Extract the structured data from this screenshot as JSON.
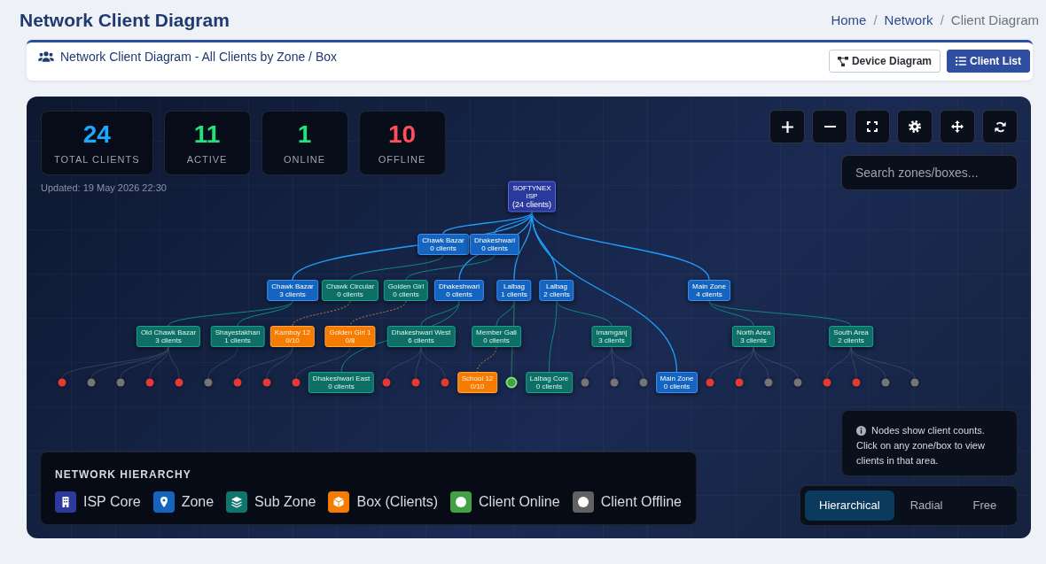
{
  "header": {
    "title": "Network Client Diagram",
    "separator": "/",
    "breadcrumb": [
      {
        "label": "Home",
        "current": false
      },
      {
        "label": "Network",
        "current": false
      },
      {
        "label": "Client Diagram",
        "current": true
      }
    ]
  },
  "card": {
    "title": "Network Client Diagram - All Clients by Zone / Box",
    "buttons": [
      {
        "label": "Device Diagram",
        "kind": "outline"
      },
      {
        "label": "Client List",
        "kind": "primary"
      }
    ]
  },
  "diagram": {
    "stats": [
      {
        "value": "24",
        "label": "TOTAL CLIENTS",
        "color": "#1ea7ff"
      },
      {
        "value": "11",
        "label": "ACTIVE",
        "color": "#22e07a"
      },
      {
        "value": "1",
        "label": "ONLINE",
        "color": "#22e07a"
      },
      {
        "value": "10",
        "label": "OFFLINE",
        "color": "#ff4d5e"
      }
    ],
    "updated": "Updated: 19 May 2026 22:30",
    "search": {
      "placeholder": "Search zones/boxes..."
    },
    "tree": {
      "kind": "isp",
      "name": "SOFTYNEX ISP",
      "count": "(24 clients)",
      "children": [
        {
          "kind": "zone",
          "name": "Chawk Bazar",
          "count": "3 clients",
          "children": [
            {
              "kind": "subzone",
              "name": "Old Chawk Bazar",
              "count": "3 clients",
              "children": [
                {
                  "kind": "client",
                  "color": "#e53935"
                },
                {
                  "kind": "client",
                  "color": "#757575"
                },
                {
                  "kind": "client",
                  "color": "#757575"
                },
                {
                  "kind": "client",
                  "color": "#e53935"
                },
                {
                  "kind": "client",
                  "color": "#e53935"
                }
              ]
            },
            {
              "kind": "subzone",
              "name": "Shayestakhan",
              "count": "1 clients",
              "children": [
                {
                  "kind": "client",
                  "color": "#757575"
                }
              ]
            }
          ]
        },
        {
          "kind": "zone",
          "name": "Chawk Bazar",
          "count": "0 clients",
          "children": [
            {
              "kind": "subzone",
              "name": "Chawk Circular",
              "count": "0 clients",
              "children": [
                {
                  "kind": "box",
                  "name": "Kamboy 12",
                  "count": "0/10",
                  "children": [
                    {
                      "kind": "client",
                      "color": "#e53935"
                    },
                    {
                      "kind": "client",
                      "color": "#e53935"
                    }
                  ]
                }
              ]
            }
          ]
        },
        {
          "kind": "zone",
          "name": "Dhakeshwari",
          "count": "0 clients",
          "children": [
            {
              "kind": "subzone",
              "name": "Dhakeshwari East",
              "count": "0 clients"
            },
            {
              "kind": "subzone",
              "name": "Dhakeshwari West",
              "count": "6 clients",
              "children": [
                {
                  "kind": "client",
                  "color": "#e53935"
                },
                {
                  "kind": "client",
                  "color": "#e53935"
                },
                {
                  "kind": "client",
                  "color": "#e53935"
                }
              ]
            }
          ]
        },
        {
          "kind": "zone",
          "name": "Dhakeshwari",
          "count": "0 clients",
          "children": [
            {
              "kind": "subzone",
              "name": "Golden Girl",
              "count": "0 clients",
              "children": [
                {
                  "kind": "box",
                  "name": "Golden Girl 1",
                  "count": "0/8",
                  "children": [
                    {
                      "kind": "client",
                      "color": "#e53935"
                    }
                  ]
                }
              ]
            }
          ]
        },
        {
          "kind": "zone",
          "name": "Lalbag",
          "count": "1 clients",
          "children": [
            {
              "kind": "subzone",
              "name": "Member Gali",
              "count": "0 clients",
              "children": [
                {
                  "kind": "box",
                  "name": "School 12",
                  "count": "0/10"
                }
              ]
            },
            {
              "kind": "client_online",
              "color": "#43a047"
            }
          ]
        },
        {
          "kind": "zone",
          "name": "Lalbag",
          "count": "2 clients",
          "children": [
            {
              "kind": "subzone",
              "name": "Lalbag Core",
              "count": "0 clients"
            },
            {
              "kind": "subzone",
              "name": "Imamganj",
              "count": "3 clients",
              "children": [
                {
                  "kind": "client",
                  "color": "#757575"
                },
                {
                  "kind": "client",
                  "color": "#757575"
                },
                {
                  "kind": "client",
                  "color": "#757575"
                }
              ]
            }
          ]
        },
        {
          "kind": "zone",
          "name": "Main Zone",
          "count": "0 clients"
        },
        {
          "kind": "zone",
          "name": "Main Zone",
          "count": "4 clients",
          "children": [
            {
              "kind": "subzone",
              "name": "North Area",
              "count": "3 clients",
              "children": [
                {
                  "kind": "client",
                  "color": "#e53935"
                },
                {
                  "kind": "client",
                  "color": "#e53935"
                },
                {
                  "kind": "client",
                  "color": "#757575"
                },
                {
                  "kind": "client",
                  "color": "#757575"
                }
              ]
            },
            {
              "kind": "subzone",
              "name": "South Area",
              "count": "2 clients",
              "children": [
                {
                  "kind": "client",
                  "color": "#e53935"
                },
                {
                  "kind": "client",
                  "color": "#e53935"
                },
                {
                  "kind": "client",
                  "color": "#757575"
                },
                {
                  "kind": "client",
                  "color": "#757575"
                }
              ]
            }
          ]
        }
      ]
    },
    "info": [
      "Nodes show client counts.",
      "Click on any zone/box to view clients in that area."
    ],
    "layouts": [
      {
        "label": "Hierarchical",
        "selected": true
      },
      {
        "label": "Radial",
        "selected": false
      },
      {
        "label": "Free",
        "selected": false
      }
    ],
    "legend": {
      "title": "NETWORK HIERARCHY",
      "items": [
        {
          "kind": "isp",
          "label": "ISP Core"
        },
        {
          "kind": "zone",
          "label": "Zone"
        },
        {
          "kind": "subzone",
          "label": "Sub Zone"
        },
        {
          "kind": "box",
          "label": "Box (Clients)"
        },
        {
          "kind": "online",
          "label": "Client Online"
        },
        {
          "kind": "offline",
          "label": "Client Offline"
        }
      ]
    }
  }
}
